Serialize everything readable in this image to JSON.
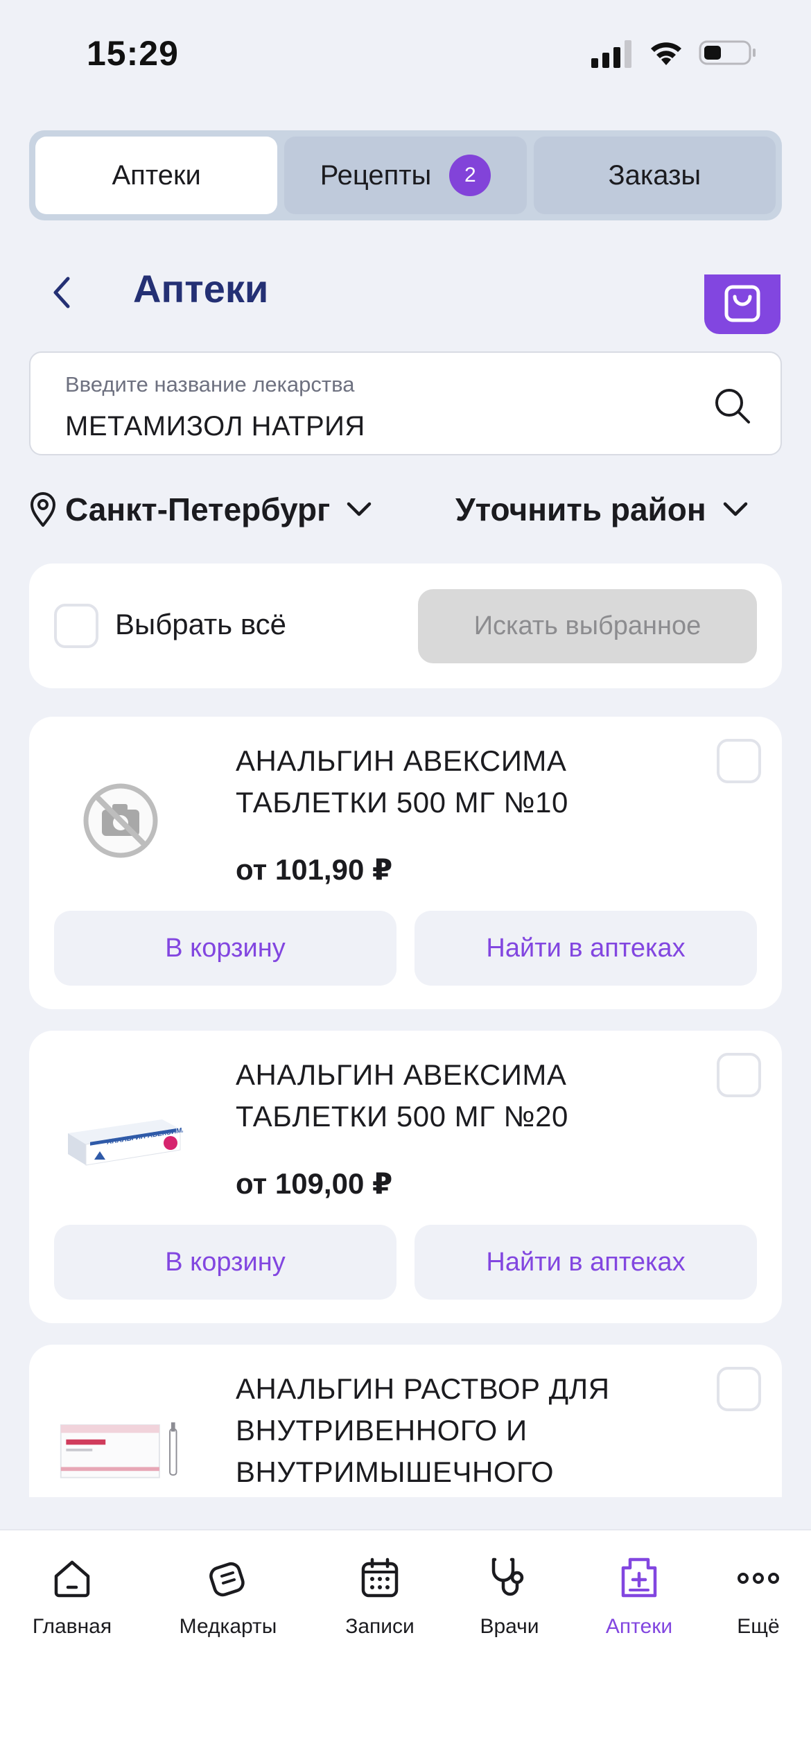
{
  "status_bar": {
    "time": "15:29"
  },
  "tabs": [
    {
      "label": "Аптеки",
      "active": true
    },
    {
      "label": "Рецепты",
      "badge": "2",
      "active": false
    },
    {
      "label": "Заказы",
      "active": false
    }
  ],
  "header": {
    "title": "Аптеки",
    "back_icon": "chevron-left-icon",
    "cart_icon": "shopping-bag-icon"
  },
  "search": {
    "placeholder": "Введите название лекарства",
    "value": "МЕТАМИЗОЛ НАТРИЯ",
    "icon": "search-icon"
  },
  "location": {
    "city": "Санкт-Петербург",
    "district": "Уточнить район"
  },
  "select_all": {
    "label": "Выбрать всё",
    "search_selected": "Искать выбранное"
  },
  "products": [
    {
      "name": "АНАЛЬГИН АВЕКСИМА ТАБЛЕТКИ 500 МГ №10",
      "price": "от 101,90 ₽",
      "image": "no-photo-icon",
      "cart_btn": "В корзину",
      "find_btn": "Найти в аптеках"
    },
    {
      "name": "АНАЛЬГИН АВЕКСИМА ТАБЛЕТКИ 500 МГ №20",
      "price": "от 109,00 ₽",
      "image": "pill-box-image",
      "cart_btn": "В корзину",
      "find_btn": "Найти в аптеках"
    },
    {
      "name": "АНАЛЬГИН РАСТВОР ДЛЯ ВНУТРИВЕННОГО И ВНУТРИМЫШЕЧНОГО",
      "image": "ampoule-box-image"
    }
  ],
  "product_image_text": {
    "box": "АНАЛЬГИН АВЕКСИМА"
  },
  "bottom_nav": [
    {
      "label": "Главная",
      "icon": "home-icon"
    },
    {
      "label": "Медкарты",
      "icon": "medcard-icon"
    },
    {
      "label": "Записи",
      "icon": "calendar-icon"
    },
    {
      "label": "Врачи",
      "icon": "stethoscope-icon"
    },
    {
      "label": "Аптеки",
      "icon": "pharmacy-icon",
      "active": true
    },
    {
      "label": "Ещё",
      "icon": "more-icon"
    }
  ],
  "colors": {
    "accent": "#8246e0",
    "title": "#243074",
    "background": "#eff1f7",
    "tabs_bg": "#c9d4e2"
  }
}
